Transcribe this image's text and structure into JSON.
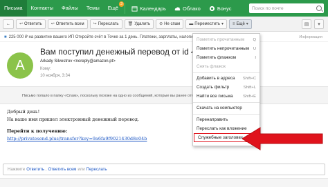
{
  "topnav": {
    "tabs": [
      {
        "label": "Письма"
      },
      {
        "label": "Контакты"
      },
      {
        "label": "Файлы"
      },
      {
        "label": "Темы"
      },
      {
        "label": "Ещё"
      }
    ],
    "more_badge": "3",
    "services": [
      {
        "label": "Календарь",
        "icon": "calendar-icon"
      },
      {
        "label": "Облако",
        "icon": "cloud-icon"
      },
      {
        "label": "Бонус",
        "icon": "bonus-icon"
      }
    ],
    "search_placeholder": "Поиск по почте"
  },
  "toolbar": {
    "back": "←",
    "reply": "Ответить",
    "reply_all": "Ответить всем",
    "forward": "Переслать",
    "delete": "Удалить",
    "not_spam": "Не спам",
    "move": "Переместить",
    "more": "Ещё"
  },
  "ad": {
    "text": "225 000 ₽ на развитие вашего ИП Откройте счёт в Точке за 1 день. Платежи, зарплаты, налоги...",
    "info": "Информация"
  },
  "email": {
    "avatar_letter": "A",
    "subject": "Вам поступил денежный перевод от id 4555",
    "sender": "Arkady Silvestrov <noreply@amazon.pt>",
    "to_label": "Кому:",
    "date": "10 ноября, 3:34",
    "spam_notice": "Письмо попало в папку «Спам», поскольку похоже на одно из сообщений, которые вы ранее отметили как спам. Подробнее",
    "greeting": "Добрый день!",
    "body_line": "На ваше имя пришел электронный денежный перевод.",
    "follow_label": "Перейти к получению:",
    "link": "http://privatesend.plus/transfer?key=9a6fa9f9021430d8e04b"
  },
  "reply_box": {
    "prefix": "Нажмите",
    "reply": "Ответить",
    "reply_all": "Ответить всем",
    "or": "или",
    "forward": "Переслать"
  },
  "menu": {
    "items": [
      {
        "label": "Пометить прочитанным",
        "shortcut": "Q",
        "disabled": true
      },
      {
        "label": "Пометить непрочитанным",
        "shortcut": "U",
        "disabled": false
      },
      {
        "label": "Пометить флажком",
        "shortcut": "I",
        "disabled": false
      },
      {
        "label": "Снять флажок",
        "shortcut": "",
        "disabled": true
      },
      {
        "label": "Добавить в адреса",
        "shortcut": "Shift+C",
        "disabled": false
      },
      {
        "label": "Создать фильтр",
        "shortcut": "Shift+L",
        "disabled": false
      },
      {
        "label": "Найти все письма",
        "shortcut": "Shift+E",
        "disabled": false
      },
      {
        "label": "Скачать на компьютер",
        "shortcut": "",
        "disabled": false
      },
      {
        "label": "Перенаправить",
        "shortcut": "",
        "disabled": false
      },
      {
        "label": "Переслать как вложение",
        "shortcut": "",
        "disabled": false
      },
      {
        "label": "Служебные заголовки",
        "shortcut": "",
        "disabled": false
      }
    ]
  },
  "colors": {
    "nav_green": "#2c9a4b",
    "highlight_red": "#e0131c",
    "link_blue": "#1a55c4"
  }
}
